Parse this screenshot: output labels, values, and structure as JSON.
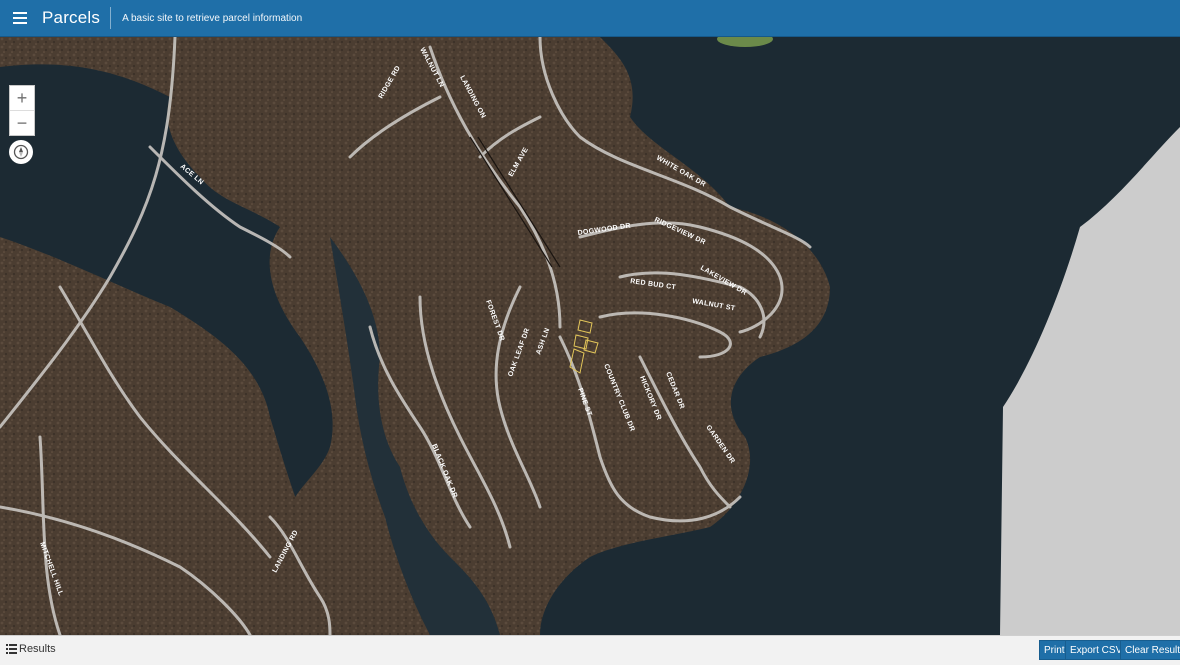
{
  "header": {
    "title": "Parcels",
    "subtitle": "A basic site to retrieve parcel information",
    "menu_icon": "hamburger-menu-icon"
  },
  "map": {
    "zoom_in_label": "+",
    "zoom_out_label": "−",
    "locate_icon": "locate-compass-icon",
    "basemap": "satellite imagery",
    "colors": {
      "water": "#1c2a33",
      "land": "#4a3c31",
      "road": "#c9c6c2",
      "parcel": "#e3c65a",
      "nodata": "#cccccc"
    },
    "road_labels": [
      "RIDGE RD",
      "WALNUT LN",
      "LANDING ON",
      "ELM AVE",
      "ACE LN",
      "WHITE OAK DR",
      "DOGWOOD DR",
      "RIDGEVIEW DR",
      "LAKEVIEW DR",
      "RED BUD CT",
      "WALNUT ST",
      "FOREST DR",
      "OAK LEAF DR",
      "ASH LN",
      "PINE ST",
      "COUNTRY CLUB DR",
      "HICKORY DR",
      "CEDAR DR",
      "GARDEN DR",
      "BLACK OAK DR",
      "LANDING RD",
      "MITCHELL HILL"
    ]
  },
  "footer": {
    "results_label": "Results",
    "results_icon": "list-icon",
    "buttons": {
      "print": "Print",
      "export_csv": "Export CSV",
      "clear_results": "Clear Results"
    }
  }
}
